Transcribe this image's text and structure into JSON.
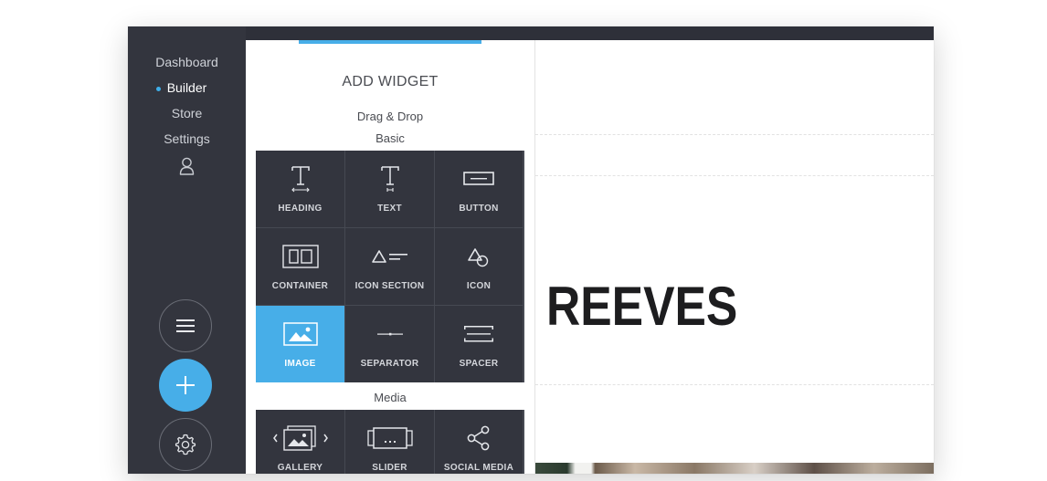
{
  "nav": {
    "items": [
      {
        "label": "Dashboard",
        "active": false
      },
      {
        "label": "Builder",
        "active": true
      },
      {
        "label": "Store",
        "active": false
      },
      {
        "label": "Settings",
        "active": false
      }
    ],
    "user_icon": "user-icon",
    "buttons": [
      {
        "icon": "hamburger-menu-icon"
      },
      {
        "icon": "plus-icon"
      },
      {
        "icon": "gear-icon"
      }
    ]
  },
  "panel": {
    "title": "ADD WIDGET",
    "subtitle": "Drag & Drop",
    "sections": [
      {
        "label": "Basic",
        "widgets": [
          {
            "label": "HEADING",
            "icon": "heading-icon",
            "active": false
          },
          {
            "label": "TEXT",
            "icon": "text-icon",
            "active": false
          },
          {
            "label": "BUTTON",
            "icon": "button-icon",
            "active": false
          },
          {
            "label": "CONTAINER",
            "icon": "container-icon",
            "active": false
          },
          {
            "label": "ICON SECTION",
            "icon": "icon-section-icon",
            "active": false
          },
          {
            "label": "ICON",
            "icon": "icon-icon",
            "active": false
          },
          {
            "label": "IMAGE",
            "icon": "image-icon",
            "active": true
          },
          {
            "label": "SEPARATOR",
            "icon": "separator-icon",
            "active": false
          },
          {
            "label": "SPACER",
            "icon": "spacer-icon",
            "active": false
          }
        ]
      },
      {
        "label": "Media",
        "widgets": [
          {
            "label": "GALLERY",
            "icon": "gallery-icon",
            "active": false
          },
          {
            "label": "SLIDER",
            "icon": "slider-icon",
            "active": false
          },
          {
            "label": "SOCIAL MEDIA",
            "icon": "share-icon",
            "active": false
          }
        ]
      }
    ]
  },
  "canvas": {
    "hero_text": "REEVES"
  },
  "colors": {
    "accent": "#47aee8",
    "sidebar": "#33353e",
    "topbar": "#2e3039",
    "tile": "#33353e"
  }
}
